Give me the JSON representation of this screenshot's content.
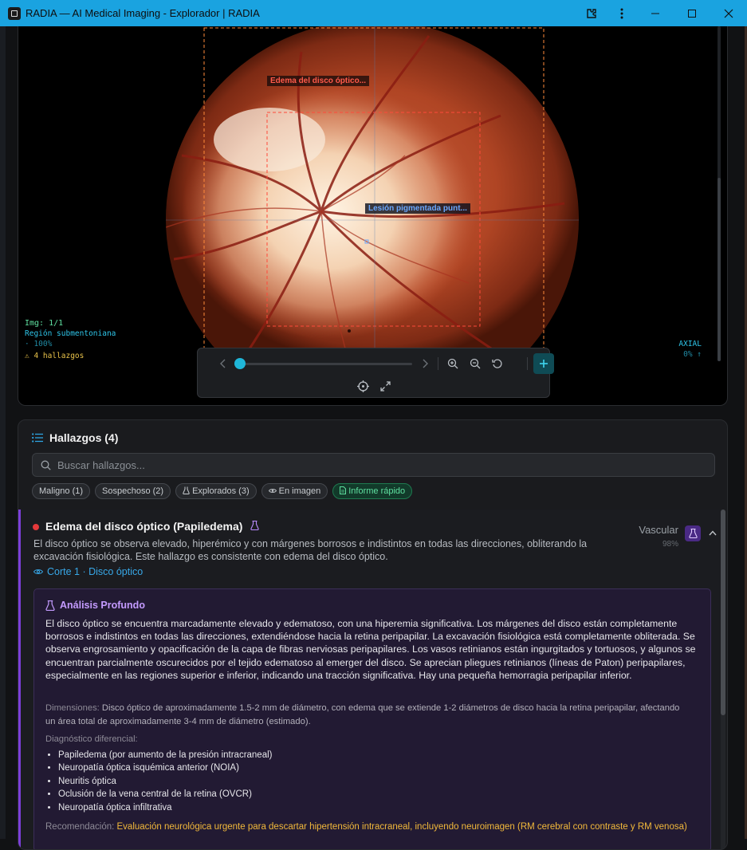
{
  "window": {
    "title": "RADIA — AI Medical Imaging - Explorador | RADIA",
    "controls": [
      "extensions-icon",
      "more-icon",
      "minimize-icon",
      "maximize-icon",
      "close-icon"
    ]
  },
  "viewer": {
    "roi_labels": [
      {
        "text": "Edema del disco óptico...",
        "color": "#ff5a4a"
      },
      {
        "text": "Lesión pigmentada punt...",
        "color": "#6aa8ff"
      }
    ],
    "info": {
      "image_index": "Img: 1/1",
      "region": "Región submentoniana",
      "zoom": "· 100%",
      "findings_count": "⚠ 4 hallazgos"
    },
    "axial": {
      "label": "AXIAL",
      "sub": "0% ↑"
    },
    "slider_position": 0,
    "toolbar_icons": [
      "chevron-left-icon",
      "chevron-right-icon",
      "zoom-in-icon",
      "zoom-out-icon",
      "rotate-icon",
      "add-icon",
      "crosshair-icon",
      "fullscreen-icon"
    ]
  },
  "findings": {
    "header_title": "Hallazgos (4)",
    "search_placeholder": "Buscar hallazgos...",
    "filters": [
      {
        "label": "Maligno (1)",
        "icon": ""
      },
      {
        "label": "Sospechoso (2)",
        "icon": ""
      },
      {
        "label": "Explorados (3)",
        "icon": "flask-icon"
      },
      {
        "label": "En imagen",
        "icon": "eye-icon"
      },
      {
        "label": "Informe rápido",
        "icon": "document-icon",
        "active": true
      }
    ],
    "items": [
      {
        "title": "Edema del disco óptico (Papiledema)",
        "category": "Vascular",
        "confidence": "98%",
        "severity_color": "#e5393b",
        "description": "El disco óptico se observa elevado, hiperémico y con márgenes borrosos e indistintos en todas las direcciones, obliterando la excavación fisiológica. Este hallazgo es consistente con edema del disco óptico.",
        "slice_ref": "Corte 1 · Disco óptico",
        "deep_analysis": {
          "title": "Análisis Profundo",
          "body": "El disco óptico se encuentra marcadamente elevado y edematoso, con una hiperemia significativa. Los márgenes del disco están completamente borrosos e indistintos en todas las direcciones, extendiéndose hacia la retina peripapilar. La excavación fisiológica está completamente obliterada. Se observa engrosamiento y opacificación de la capa de fibras nerviosas peripapilares. Los vasos retinianos están ingurgitados y tortuosos, y algunos se encuentran parcialmente oscurecidos por el tejido edematoso al emerger del disco. Se aprecian pliegues retinianos (líneas de Paton) peripapilares, especialmente en las regiones superior e inferior, indicando una tracción significativa. Hay una pequeña hemorragia peripapilar inferior.",
          "dimensions_label": "Dimensiones:",
          "dimensions": "Disco óptico de aproximadamente 1.5-2 mm de diámetro, con edema que se extiende 1-2 diámetros de disco hacia la retina peripapilar, afectando un área total de aproximadamente 3-4 mm de diámetro (estimado).",
          "differential_label": "Diagnóstico diferencial:",
          "differential": [
            "Papiledema (por aumento de la presión intracraneal)",
            "Neuropatía óptica isquémica anterior (NOIA)",
            "Neuritis óptica",
            "Oclusión de la vena central de la retina (OVCR)",
            "Neuropatía óptica infiltrativa"
          ],
          "recommendation_label": "Recomendación:",
          "recommendation": "Evaluación neurológica urgente para descartar hipertensión intracraneal, incluyendo neuroimagen (RM cerebral con contraste y RM venosa)"
        }
      }
    ]
  },
  "colors": {
    "titlebar": "#1aa3e0",
    "accent": "#1fb6d8",
    "deep_bg": "#221a33",
    "recommendation": "#f2b93b"
  }
}
